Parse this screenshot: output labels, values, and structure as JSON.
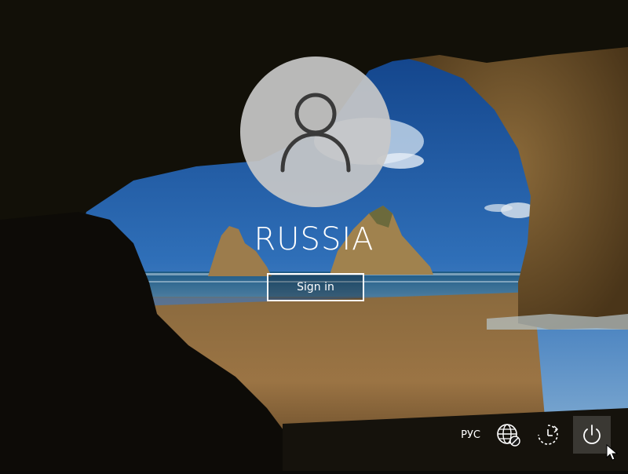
{
  "login": {
    "user_name": "RUSSIA",
    "sign_in_label": "Sign in"
  },
  "tray": {
    "language": "РУС",
    "icons": [
      "network-icon",
      "accessibility-icon",
      "power-icon"
    ]
  },
  "colors": {
    "text": "#ffffff",
    "avatar_bg": "#c8c8c8",
    "avatar_glyph": "#3a3a3a",
    "power_hover": "#3a3a3a"
  }
}
